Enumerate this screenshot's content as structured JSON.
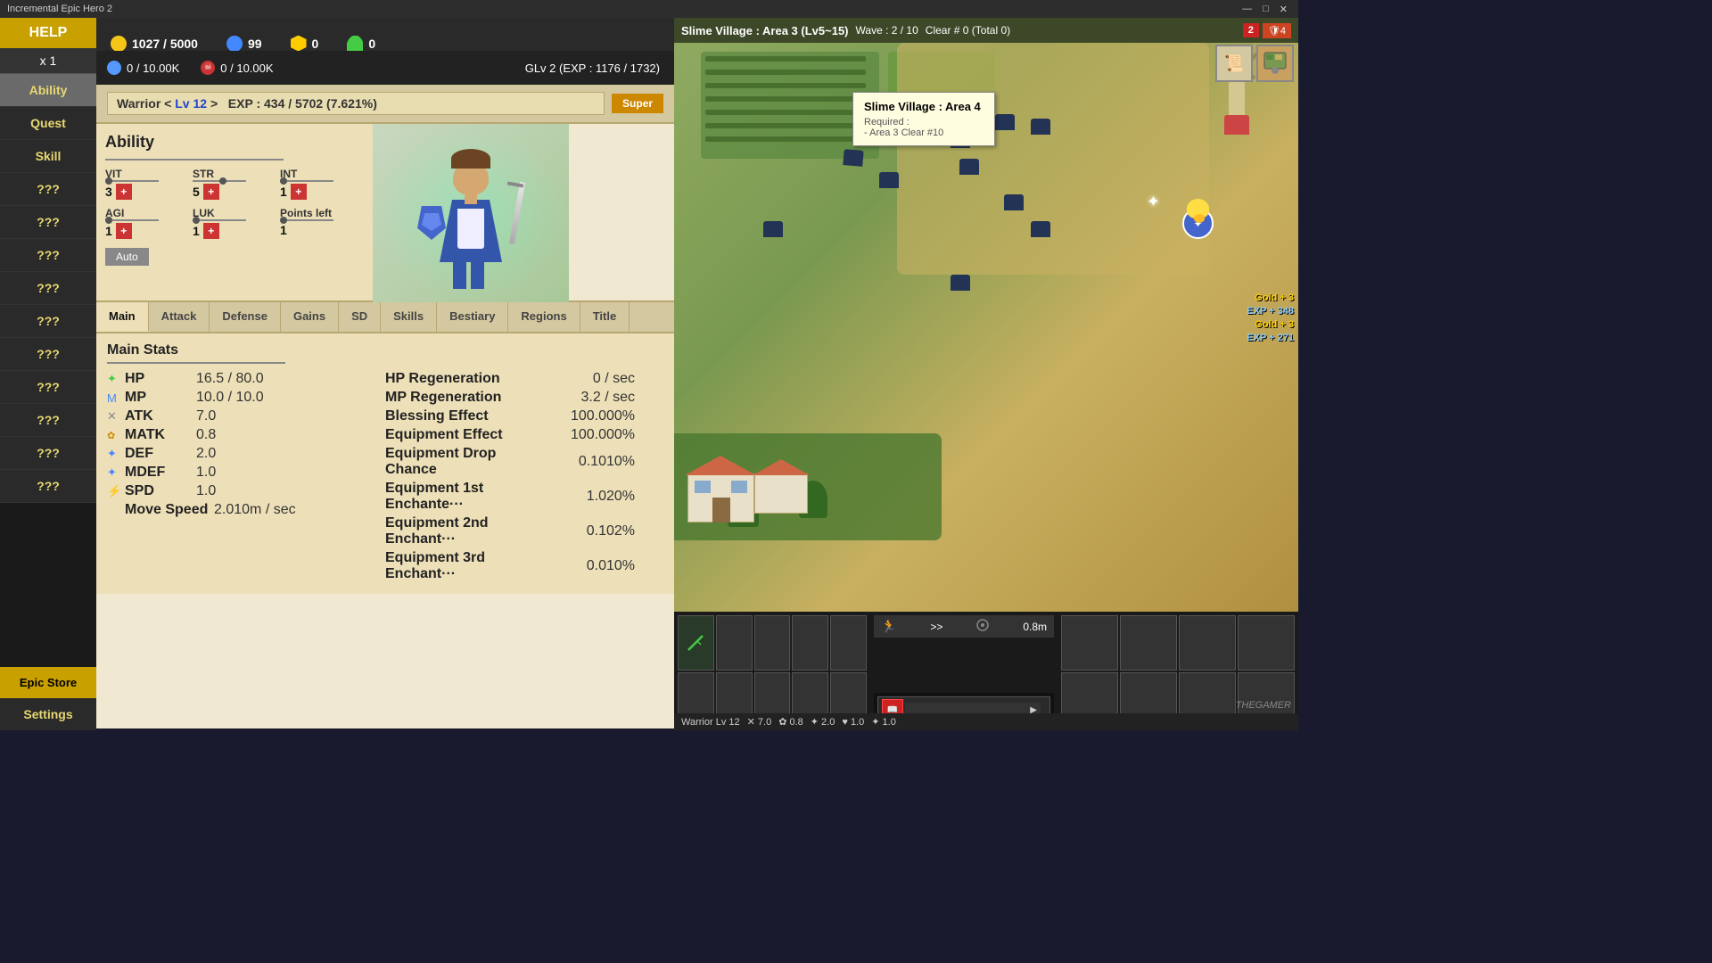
{
  "titleBar": {
    "title": "Incremental Epic Hero 2",
    "minimize": "—",
    "restore": "□",
    "close": "✕"
  },
  "topBar": {
    "gold": "1027 / 5000",
    "blue": "99",
    "hex": "0",
    "leaf": "0",
    "blueCircle": "0 / 10.00K",
    "redSkull": "0 / 10.00K",
    "glv": "GLv 2 (EXP : 1176 / 1732)"
  },
  "sidebar": {
    "help": "HELP",
    "multiplier": "x 1",
    "ability": "Ability",
    "quest": "Quest",
    "skill": "Skill",
    "items": [
      "???",
      "???",
      "???",
      "???",
      "???",
      "???",
      "???",
      "???",
      "???",
      "???"
    ],
    "epicStore": "Epic Store",
    "settings": "Settings"
  },
  "character": {
    "name": "Warrior",
    "level": "Lv 12",
    "exp": "EXP : 434 / 5702 (7.621%)",
    "superLabel": "Super"
  },
  "ability": {
    "title": "Ability",
    "stats": {
      "vit": {
        "label": "VIT",
        "value": "3"
      },
      "str": {
        "label": "STR",
        "value": "5"
      },
      "int": {
        "label": "INT",
        "value": "1"
      },
      "agi": {
        "label": "AGI",
        "value": "1"
      },
      "luk": {
        "label": "LUK",
        "value": "1"
      },
      "pointsLeft": {
        "label": "Points left",
        "value": "1"
      }
    },
    "autoLabel": "Auto"
  },
  "tabs": {
    "items": [
      "Main",
      "Attack",
      "Defense",
      "Gains",
      "SD",
      "Skills",
      "Bestiary",
      "Regions",
      "Title"
    ],
    "active": "Main"
  },
  "mainStats": {
    "title": "Main Stats",
    "leftCol": [
      {
        "icon": "hp-icon",
        "name": "HP",
        "value": "16.5 / 80.0"
      },
      {
        "icon": "mp-icon",
        "name": "MP",
        "value": "10.0 / 10.0"
      },
      {
        "icon": "atk-icon",
        "name": "ATK",
        "value": "7.0"
      },
      {
        "icon": "matk-icon",
        "name": "MATK",
        "value": "0.8"
      },
      {
        "icon": "def-icon",
        "name": "DEF",
        "value": "2.0"
      },
      {
        "icon": "mdef-icon",
        "name": "MDEF",
        "value": "1.0"
      },
      {
        "icon": "spd-icon",
        "name": "SPD",
        "value": "1.0"
      },
      {
        "icon": "move-icon",
        "name": "Move Speed",
        "value": "2.010m / sec"
      }
    ],
    "rightCol": [
      {
        "name": "HP Regeneration",
        "value": "0 / sec"
      },
      {
        "name": "MP Regeneration",
        "value": "3.2 / sec"
      },
      {
        "name": "Blessing Effect",
        "value": "100.000%"
      },
      {
        "name": "Equipment Effect",
        "value": "100.000%"
      },
      {
        "name": "Equipment Drop Chance",
        "value": "0.1010%"
      },
      {
        "name": "Equipment 1st Enchante···",
        "value": "1.020%"
      },
      {
        "name": "Equipment 2nd Enchant···",
        "value": "0.102%"
      },
      {
        "name": "Equipment 3rd Enchant···",
        "value": "0.010%"
      }
    ]
  },
  "gamePanel": {
    "areaName": "Slime Village : Area 3 (Lv5~15)",
    "wave": "Wave : 2 / 10",
    "clear": "Clear # 0 (Total 0)",
    "hpNum": "2",
    "hpIcon": "4",
    "tooltip": {
      "title": "Slime Village : Area 4",
      "required": "Required :",
      "condition": "- Area 3 Clear #10"
    },
    "floatingGold1": "Gold + 3",
    "floatingExp1": "EXP + 348",
    "floatingGold2": "Gold + 3",
    "floatingExp2": "EXP + 271",
    "moveSpeed": "0.8m",
    "watermark": "THEGAMER"
  },
  "bottomBar": {
    "warriorInfo": "Warrior Lv 12",
    "atk": "7.0",
    "matk": "0.8",
    "def": "2.0",
    "hp": "1.0",
    "mdef": "1.0"
  }
}
